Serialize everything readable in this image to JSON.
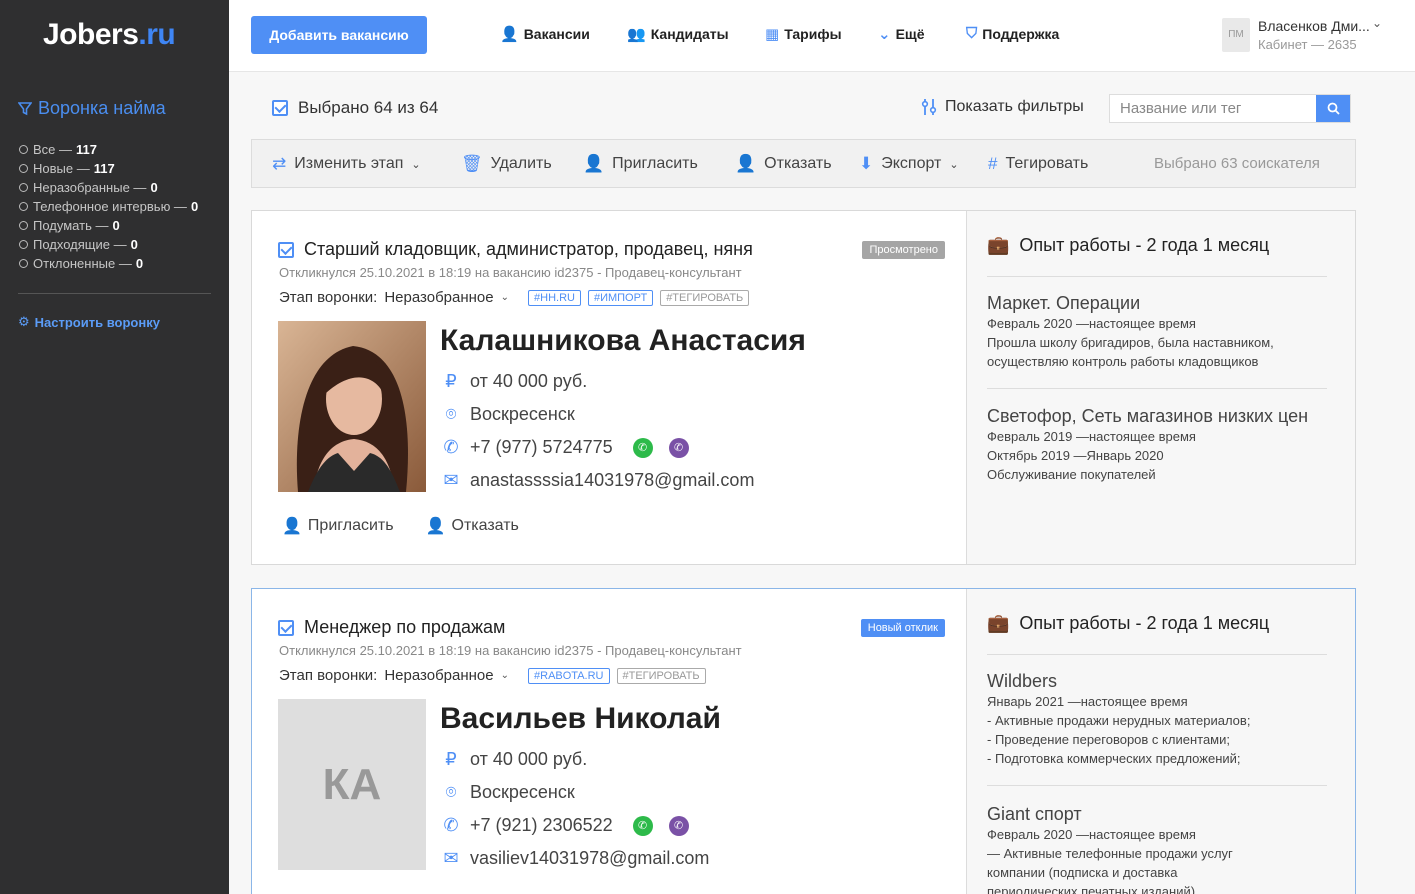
{
  "sidebar": {
    "logo_main": "Jobers",
    "logo_tld": ".ru",
    "funnel_title": "Воронка найма",
    "funnel_items": [
      {
        "label": "Все —",
        "count": "117"
      },
      {
        "label": "Новые —",
        "count": "117"
      },
      {
        "label": "Неразобранные —",
        "count": "0"
      },
      {
        "label": "Телефонное интервью —",
        "count": "0"
      },
      {
        "label": "Подумать —",
        "count": "0"
      },
      {
        "label": "Подходящие —",
        "count": "0"
      },
      {
        "label": "Отклоненные —",
        "count": "0"
      }
    ],
    "setup_label": "Настроить воронку"
  },
  "header": {
    "add_vacancy": "Добавить вакансию",
    "nav": [
      {
        "label": "Вакансии",
        "icon": "user-plus-icon"
      },
      {
        "label": "Кандидаты",
        "icon": "users-icon"
      },
      {
        "label": "Тарифы",
        "icon": "calculator-icon"
      },
      {
        "label": "Ещё",
        "icon": "chevron-down-icon"
      },
      {
        "label": "Поддержка",
        "icon": "shield-icon"
      }
    ],
    "user_initials": "ПМ",
    "user_name": "Власенков Дми...",
    "user_cabinet": "Кабинет — 2635"
  },
  "selection": {
    "selected_text": "Выбрано 64 из 64",
    "show_filters": "Показать фильтры",
    "search_placeholder": "Название или тег"
  },
  "toolbar": {
    "change_stage": "Изменить этап",
    "delete": "Удалить",
    "invite": "Пригласить",
    "reject": "Отказать",
    "export": "Экспорт",
    "tag": "Тегировать",
    "selected_count": "Выбрано 63 соискателя"
  },
  "candidates": [
    {
      "vacancy": "Старший кладовщик, администратор, продавец, няня",
      "status": "Просмотрено",
      "response": "Откликнулся 25.10.2021 в 18:19 на вакансию id2375 - Продавец-консультант",
      "stage_label": "Этап воронки:",
      "stage_value": "Неразобранное",
      "tags": [
        "#HH.RU",
        "#ИМПОРТ",
        "#ТЕГИРОВАТЬ"
      ],
      "name": "Калашникова Анастасия",
      "salary": "от 40 000 руб.",
      "city": "Воскресенск",
      "phone": "+7 (977) 5724775",
      "email": "anastassssia14031978@gmail.com",
      "initials": "",
      "invite": "Пригласить",
      "reject": "Отказать",
      "experience_title": "Опыт работы - 2 года 1 месяц",
      "jobs": [
        {
          "company": "Маркет. Операции",
          "lines": [
            "Февраль 2020 —настоящее время",
            "Прошла школу бригадиров, была наставником,",
            "осуществляю контроль работы кладовщиков"
          ]
        },
        {
          "company": "Светофор, Сеть магазинов низких цен",
          "lines": [
            "Февраль 2019 —настоящее время",
            "Октябрь 2019 —Январь 2020",
            "Обслуживание покупателей"
          ]
        }
      ]
    },
    {
      "vacancy": "Менеджер по продажам",
      "status": "Новый отклик",
      "response": "Откликнулся 25.10.2021 в 18:19 на вакансию id2375 - Продавец-консультант",
      "stage_label": "Этап воронки:",
      "stage_value": "Неразобранное",
      "tags": [
        "#RABOTA.RU",
        "#ТЕГИРОВАТЬ"
      ],
      "name": "Васильев Николай",
      "salary": "от 40 000 руб.",
      "city": "Воскресенск",
      "phone": "+7 (921) 2306522",
      "email": "vasiliev14031978@gmail.com",
      "initials": "КА",
      "experience_title": "Опыт работы - 2 года 1 месяц",
      "jobs": [
        {
          "company": "Wildbers",
          "lines": [
            "Январь 2021 —настоящее время",
            "- Активные продажи нерудных материалов;",
            "- Проведение переговоров с клиентами;",
            "- Подготовка коммерческих предложений;"
          ]
        },
        {
          "company": "Giant спорт",
          "lines": [
            "Февраль 2020 —настоящее время",
            "— Активные телефонные продажи услуг",
            "компании (подписка и доставка",
            "периодических печатных изданий)"
          ]
        }
      ]
    }
  ],
  "colors": {
    "accent": "#4f8ff5",
    "sidebar_bg": "#2f2f30",
    "viewed_badge": "#a5a5a5",
    "whatsapp": "#2dba4a",
    "viber": "#7a51a6"
  }
}
